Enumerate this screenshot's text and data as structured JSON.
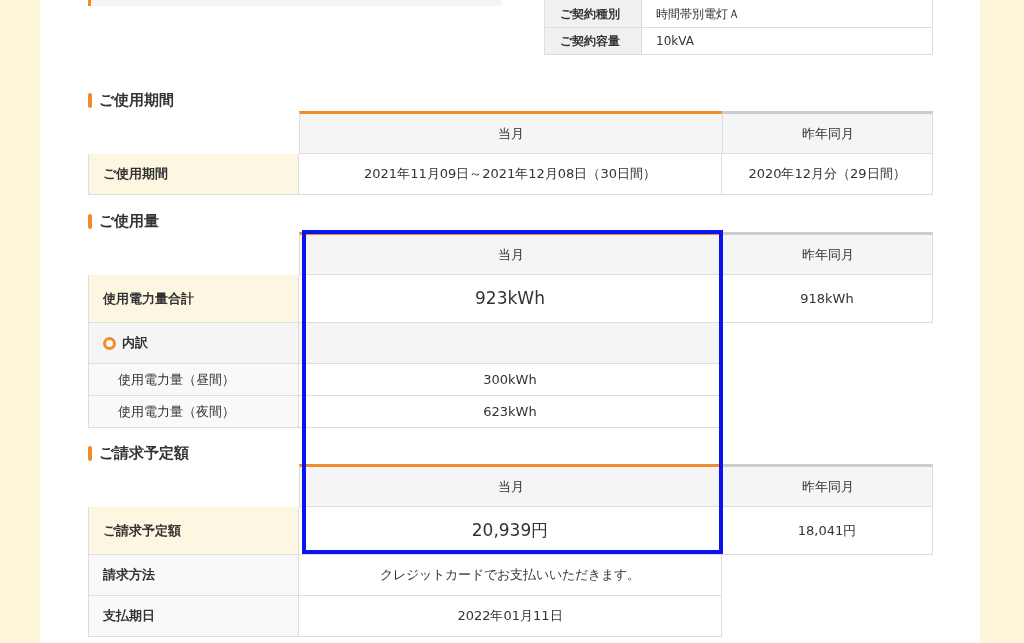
{
  "contract": [
    {
      "label": "ご契約種別",
      "value": "時間帯別電灯Ａ"
    },
    {
      "label": "ご契約容量",
      "value": "10kVA"
    }
  ],
  "sections": [
    {
      "title": "ご使用期間",
      "columns": [
        "当月",
        "昨年同月"
      ],
      "rows": [
        {
          "kind": "main",
          "large": false,
          "label": "ご使用期間",
          "current": "2021年11月09日～2021年12月08日（30日間）",
          "last_year": "2020年12月分（29日間）"
        }
      ]
    },
    {
      "title": "ご使用量",
      "columns": [
        "当月",
        "昨年同月"
      ],
      "rows": [
        {
          "kind": "main",
          "large": true,
          "label": "使用電力量合計",
          "current": "923kWh",
          "last_year": "918kWh"
        },
        {
          "kind": "group",
          "label": "内訳"
        },
        {
          "kind": "sub",
          "label": "使用電力量（昼間）",
          "current": "300kWh"
        },
        {
          "kind": "sub",
          "label": "使用電力量（夜間）",
          "current": "623kWh"
        }
      ]
    },
    {
      "title": "ご請求予定額",
      "columns": [
        "当月",
        "昨年同月"
      ],
      "rows": [
        {
          "kind": "main",
          "large": true,
          "label": "ご請求予定額",
          "current": "20,939円",
          "last_year": "18,041円"
        },
        {
          "kind": "plain",
          "label": "請求方法",
          "current": "クレジットカードでお支払いいただきます。"
        },
        {
          "kind": "plain",
          "label": "支払期日",
          "current": "2022年01月11日"
        }
      ]
    }
  ],
  "highlight_current": true
}
